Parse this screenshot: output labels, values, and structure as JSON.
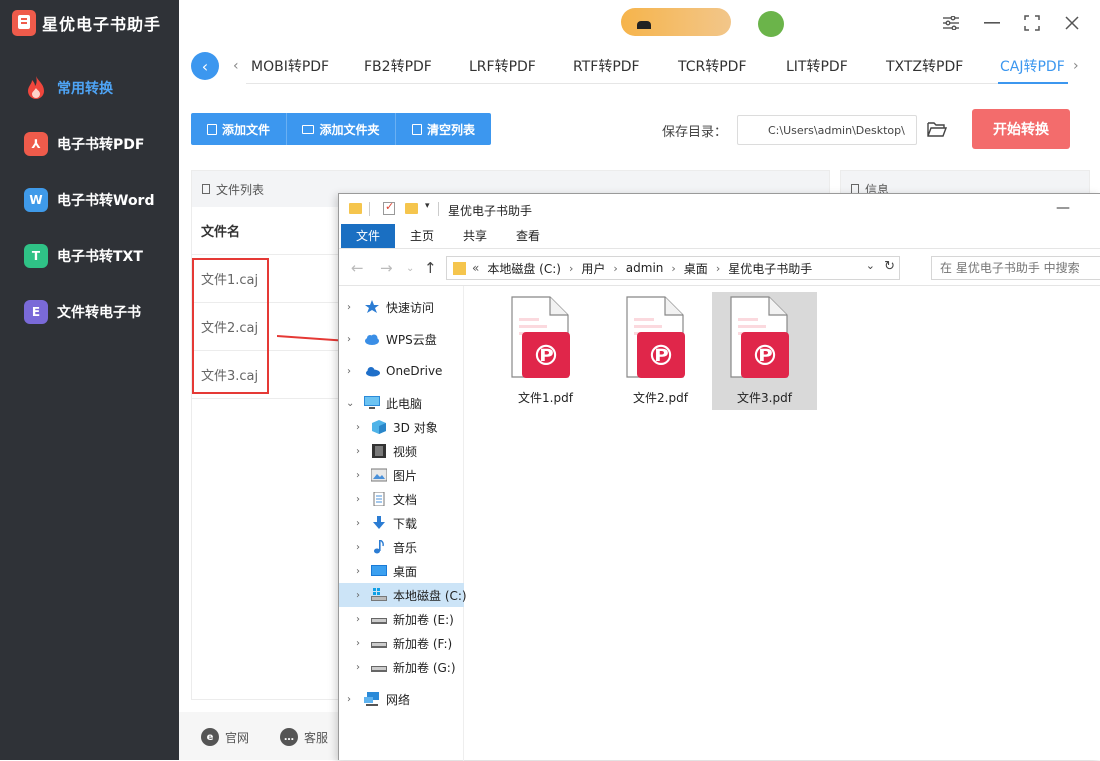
{
  "app": {
    "title": "星优电子书助手",
    "sidebar": [
      {
        "label": "常用转换",
        "icon": "fire-icon",
        "active": true
      },
      {
        "label": "电子书转PDF",
        "icon": "pdf-icon",
        "glyph": "⅄"
      },
      {
        "label": "电子书转Word",
        "icon": "word-icon",
        "glyph": "W"
      },
      {
        "label": "电子书转TXT",
        "icon": "txt-icon",
        "glyph": "T"
      },
      {
        "label": "文件转电子书",
        "icon": "ebook-icon",
        "glyph": "E"
      }
    ]
  },
  "tabs": [
    "MOBI转PDF",
    "FB2转PDF",
    "LRF转PDF",
    "RTF转PDF",
    "TCR转PDF",
    "LIT转PDF",
    "TXTZ转PDF",
    "CAJ转PDF"
  ],
  "active_tab": "CAJ转PDF",
  "toolbar": {
    "add_file": "添加文件",
    "add_folder": "添加文件夹",
    "clear_list": "清空列表",
    "save_label": "保存目录：",
    "save_path": "C:\\Users\\admin\\Desktop\\",
    "start": "开始转换"
  },
  "file_list": {
    "title": "文件列表",
    "column": "文件名",
    "files": [
      "文件1.caj",
      "文件2.caj",
      "文件3.caj"
    ]
  },
  "info_panel": {
    "title": "信息"
  },
  "footer": {
    "website": "官网",
    "support": "客服"
  },
  "explorer": {
    "title": "星优电子书助手",
    "ribbon": [
      "文件",
      "主页",
      "共享",
      "查看"
    ],
    "breadcrumb": [
      "本地磁盘 (C:)",
      "用户",
      "admin",
      "桌面",
      "星优电子书助手"
    ],
    "crumb_prefix": "«",
    "search_placeholder": "在 星优电子书助手 中搜索",
    "tree": [
      {
        "label": "快速访问",
        "icon": "star-icon"
      },
      {
        "label": "WPS云盘",
        "icon": "cloud-icon"
      },
      {
        "label": "OneDrive",
        "icon": "onedrive-icon"
      },
      {
        "label": "此电脑",
        "icon": "computer-icon"
      },
      {
        "label": "3D 对象",
        "icon": "cube-icon"
      },
      {
        "label": "视频",
        "icon": "video-icon"
      },
      {
        "label": "图片",
        "icon": "image-icon"
      },
      {
        "label": "文档",
        "icon": "document-icon"
      },
      {
        "label": "下载",
        "icon": "download-icon"
      },
      {
        "label": "音乐",
        "icon": "music-icon"
      },
      {
        "label": "桌面",
        "icon": "desktop-icon"
      },
      {
        "label": "本地磁盘 (C:)",
        "icon": "drive-icon",
        "selected": true
      },
      {
        "label": "新加卷 (E:)",
        "icon": "drive-icon"
      },
      {
        "label": "新加卷 (F:)",
        "icon": "drive-icon"
      },
      {
        "label": "新加卷 (G:)",
        "icon": "drive-icon"
      },
      {
        "label": "网络",
        "icon": "network-icon"
      }
    ],
    "files": [
      {
        "name": "文件1.pdf",
        "selected": false
      },
      {
        "name": "文件2.pdf",
        "selected": false
      },
      {
        "name": "文件3.pdf",
        "selected": true
      }
    ]
  },
  "colors": {
    "accent": "#3c97ef",
    "start_button": "#f36c6c",
    "highlight": "#e53935",
    "pdf_red": "#e0264a"
  }
}
